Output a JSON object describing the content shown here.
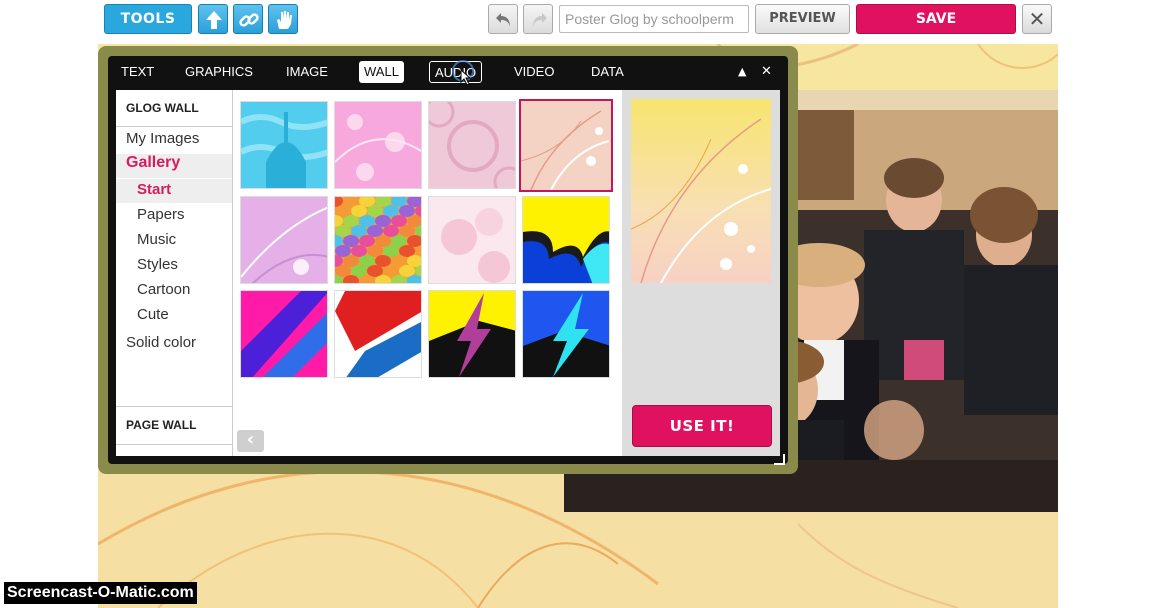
{
  "toolbar": {
    "tools_label": "TOOLS",
    "icons": [
      "upload-icon",
      "link-icon",
      "hand-icon"
    ],
    "undo_icon": "undo-icon",
    "redo_icon": "redo-icon",
    "title_placeholder": "Poster Glog by schoolperm",
    "preview_label": "PREVIEW",
    "save_label": "SAVE",
    "close_label": "✕"
  },
  "modal": {
    "tabs": [
      {
        "label": "TEXT"
      },
      {
        "label": "GRAPHICS"
      },
      {
        "label": "IMAGE"
      },
      {
        "label": "WALL"
      },
      {
        "label": "AUDIO"
      },
      {
        "label": "VIDEO"
      },
      {
        "label": "DATA"
      }
    ],
    "active_tab": "WALL",
    "hover_tab": "AUDIO",
    "minimize_label": "▲",
    "close_label": "✕"
  },
  "sidebar": {
    "glog_wall_heading": "GLOG WALL",
    "my_images": "My Images",
    "gallery": "Gallery",
    "gallery_items": [
      "Start",
      "Papers",
      "Music",
      "Styles",
      "Cartoon",
      "Cute"
    ],
    "solid_color": "Solid color",
    "page_wall_heading": "PAGE WALL"
  },
  "gallery": {
    "selected_index": 3
  },
  "preview": {
    "use_label": "USE IT!"
  },
  "watermark": "Screencast-O-Matic.com",
  "colors": {
    "accent_blue": "#2aa7dc",
    "accent_pink": "#e0115f",
    "canvas": "#f6dfa3"
  }
}
